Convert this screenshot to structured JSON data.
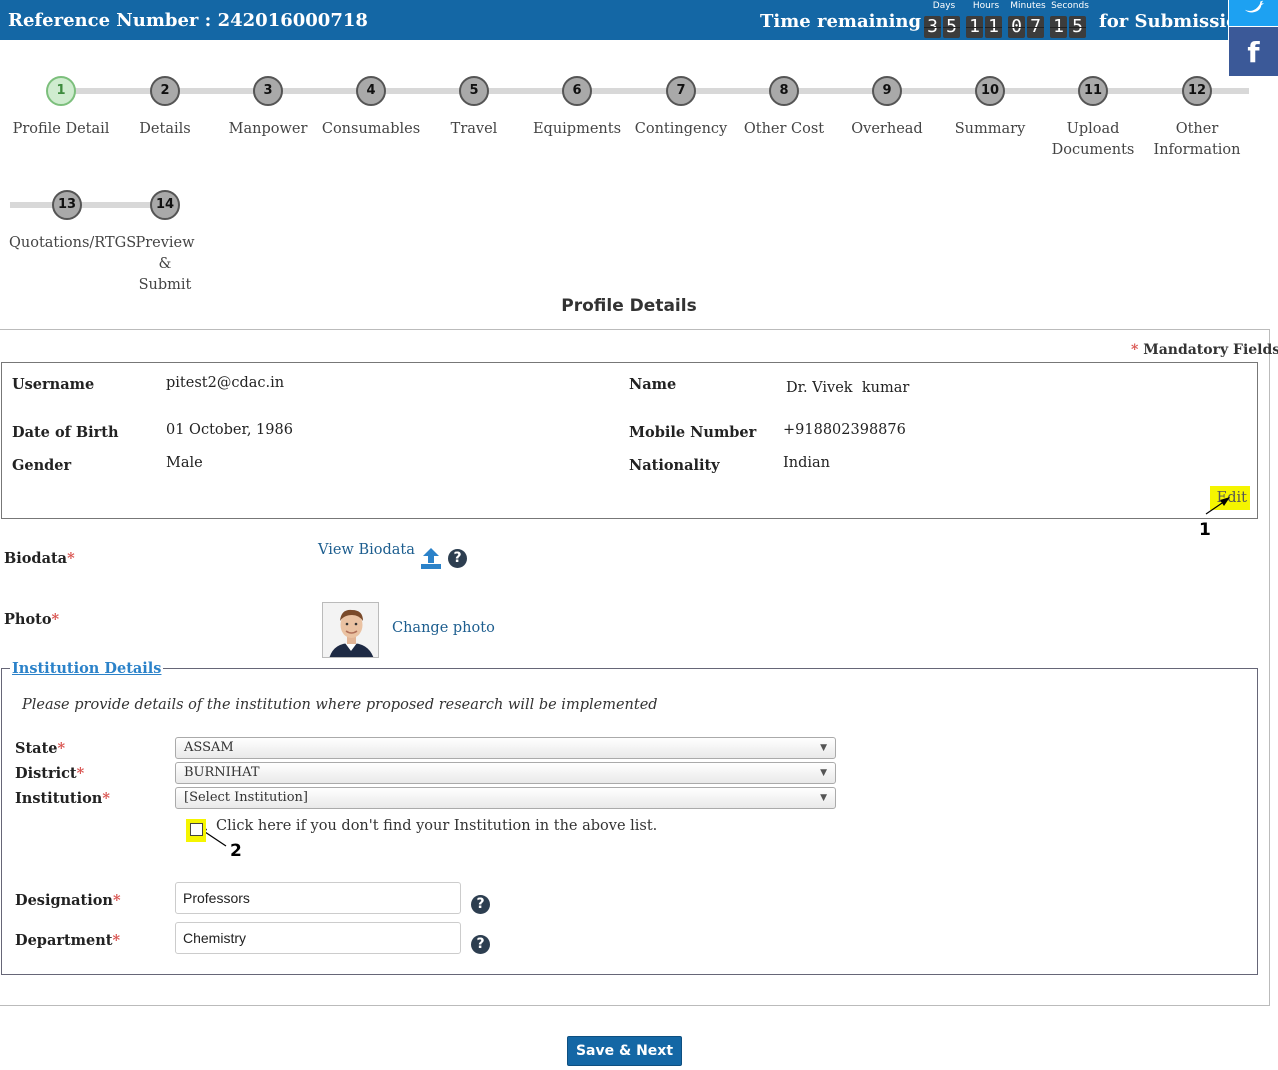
{
  "header": {
    "reference": "Reference Number : 242016000718",
    "time_remaining_label": "Time remaining",
    "submission_label": "for Submission",
    "countdown": [
      {
        "label": "Days",
        "digits": [
          "3",
          "5"
        ]
      },
      {
        "label": "Hours",
        "digits": [
          "1",
          "1"
        ]
      },
      {
        "label": "Minutes",
        "digits": [
          "0",
          "7"
        ]
      },
      {
        "label": "Seconds",
        "digits": [
          "1",
          "5"
        ]
      }
    ],
    "social": {
      "twitter_icon": "twitter-icon",
      "facebook_icon": "facebook-icon",
      "facebook_glyph": "f"
    }
  },
  "steps": [
    {
      "num": "1",
      "label": "Profile Detail",
      "active": true
    },
    {
      "num": "2",
      "label": "Details"
    },
    {
      "num": "3",
      "label": "Manpower"
    },
    {
      "num": "4",
      "label": "Consumables"
    },
    {
      "num": "5",
      "label": "Travel"
    },
    {
      "num": "6",
      "label": "Equipments"
    },
    {
      "num": "7",
      "label": "Contingency"
    },
    {
      "num": "8",
      "label": "Other Cost"
    },
    {
      "num": "9",
      "label": "Overhead"
    },
    {
      "num": "10",
      "label": "Summary"
    },
    {
      "num": "11",
      "label": "Upload Documents"
    },
    {
      "num": "12",
      "label": "Other Information"
    },
    {
      "num": "13",
      "label": "Quotations/RTGS"
    },
    {
      "num": "14",
      "label": "Preview & Submit"
    }
  ],
  "page_title": "Profile Details",
  "mandatory": {
    "star": "*",
    "text": "Mandatory Fields"
  },
  "profile": {
    "username_label": "Username",
    "username": "pitest2@cdac.in",
    "name_label": "Name",
    "name": "Dr. Vivek  kumar",
    "dob_label": "Date of Birth",
    "dob": "01 October, 1986",
    "mobile_label": "Mobile Number",
    "mobile": "+918802398876",
    "gender_label": "Gender",
    "gender": "Male",
    "nationality_label": "Nationality",
    "nationality": "Indian",
    "edit_label": "Edit"
  },
  "annotations": {
    "one": "1",
    "two": "2"
  },
  "biodata": {
    "label": "Biodata",
    "star": "*",
    "view_link": "View Biodata",
    "help": "?"
  },
  "photo": {
    "label": "Photo",
    "star": "*",
    "change_link": "Change photo"
  },
  "institution": {
    "legend": "Institution Details",
    "note": "Please provide details of the institution where proposed research will be implemented",
    "state_label": "State",
    "state_value": "ASSAM",
    "district_label": "District",
    "district_value": "BURNIHAT",
    "institution_label": "Institution",
    "institution_value": "[Select Institution]",
    "checkbox_label": "Click here if you don't find your Institution in the above list.",
    "designation_label": "Designation",
    "designation_value": "Professors",
    "department_label": "Department",
    "department_value": "Chemistry",
    "star": "*",
    "caret": "▼",
    "help": "?"
  },
  "save_button": "Save & Next",
  "colors": {
    "header_bg": "#1467a5",
    "active_step": "#cfeccf",
    "step": "#a9a9a9",
    "highlight": "#f5f500",
    "link": "#1d5e8f"
  }
}
